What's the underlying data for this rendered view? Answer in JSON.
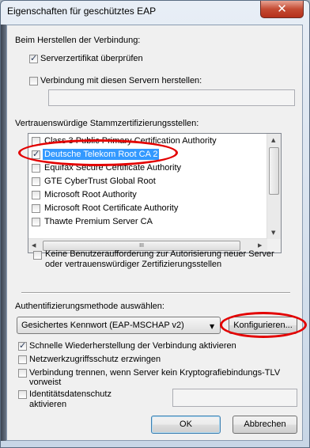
{
  "window": {
    "title": "Eigenschaften für geschütztes EAP",
    "close_glyph": "✕"
  },
  "connection": {
    "heading": "Beim Herstellen der Verbindung:",
    "verify_server_cert": {
      "label": "Serverzertifikat überprüfen",
      "checked": true
    },
    "connect_servers": {
      "label": "Verbindung mit diesen Servern herstellen:",
      "checked": false,
      "value": ""
    }
  },
  "trusted_roots": {
    "heading": "Vertrauenswürdige Stammzertifizierungsstellen:",
    "items": [
      {
        "label": "Class 3 Public Primary Certification Authority",
        "checked": false,
        "selected": false
      },
      {
        "label": "Deutsche Telekom Root CA 2",
        "checked": true,
        "selected": true
      },
      {
        "label": "Equifax Secure Certificate Authority",
        "checked": false,
        "selected": false
      },
      {
        "label": "GTE CyberTrust Global Root",
        "checked": false,
        "selected": false
      },
      {
        "label": "Microsoft Root Authority",
        "checked": false,
        "selected": false
      },
      {
        "label": "Microsoft Root Certificate Authority",
        "checked": false,
        "selected": false
      },
      {
        "label": "Thawte Premium Server CA",
        "checked": false,
        "selected": false
      }
    ],
    "hscroll_grip": "III"
  },
  "no_prompt": {
    "label_line1": "Keine Benutzeraufforderung zur Autorisierung neuer Server",
    "label_line2": "oder vertrauenswürdiger Zertifizierungsstellen",
    "checked": false
  },
  "auth": {
    "heading": "Authentifizierungsmethode auswählen:",
    "method": "Gesichertes Kennwort (EAP-MSCHAP v2)",
    "configure_label": "Konfigurieren..."
  },
  "options": {
    "fast_reconnect": {
      "label": "Schnelle Wiederherstellung der Verbindung aktivieren",
      "checked": true
    },
    "nap": {
      "label": "Netzwerkzugriffsschutz erzwingen",
      "checked": false
    },
    "crypto_binding": {
      "label_line1": "Verbindung trennen, wenn Server kein Kryptografiebindungs-TLV",
      "label_line2": "vorweist",
      "checked": false
    },
    "identity_privacy": {
      "label_line1": "Identitätsdatenschutz",
      "label_line2": "aktivieren",
      "checked": false,
      "value": ""
    }
  },
  "buttons": {
    "ok": "OK",
    "cancel": "Abbrechen"
  },
  "colors": {
    "selection": "#3399ff",
    "annotation_ring": "#e30000",
    "close_button": "#c44b33"
  }
}
